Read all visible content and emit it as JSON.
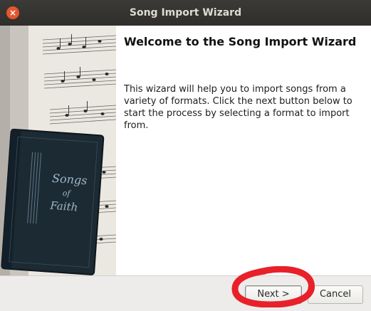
{
  "window": {
    "title": "Song Import Wizard",
    "close_icon": "×"
  },
  "side_image": {
    "book_title_line1": "Songs",
    "book_title_line2": "of",
    "book_title_line3": "Faith"
  },
  "page": {
    "heading": "Welcome to the Song Import Wizard",
    "description": "This wizard will help you to import songs from a variety of formats. Click the next button below to start the process by selecting a format to import from."
  },
  "buttons": {
    "next_label": "Next >",
    "cancel_label": "Cancel"
  },
  "colors": {
    "titlebar": "#2f2e2b",
    "close_button": "#e4572e",
    "annotation": "#e8202a",
    "book_cover": "#1c2a33"
  }
}
